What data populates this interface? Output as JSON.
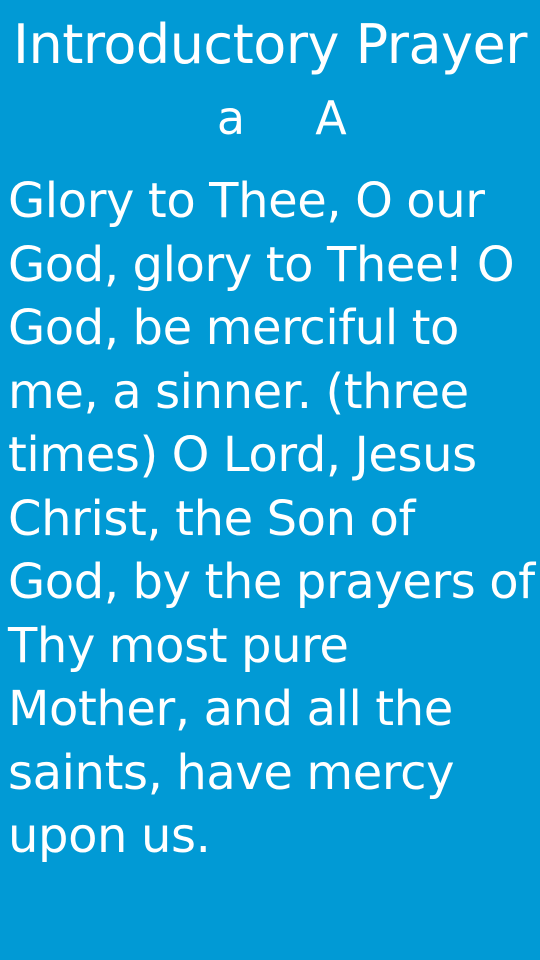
{
  "screen": {
    "title": "Introductory Prayer",
    "font_size_controls": {
      "decrease_label": "a",
      "increase_label": "A"
    },
    "prayer_text": "Glory to Thee, O our God, glory to Thee! O God, be merciful to me, a sinner. (three times) O Lord, Jesus Christ, the Son of God, by the prayers of Thy most pure Mother, and all the saints, have mercy upon us."
  },
  "colors": {
    "background": "#019ad5",
    "text": "#ffffff"
  }
}
